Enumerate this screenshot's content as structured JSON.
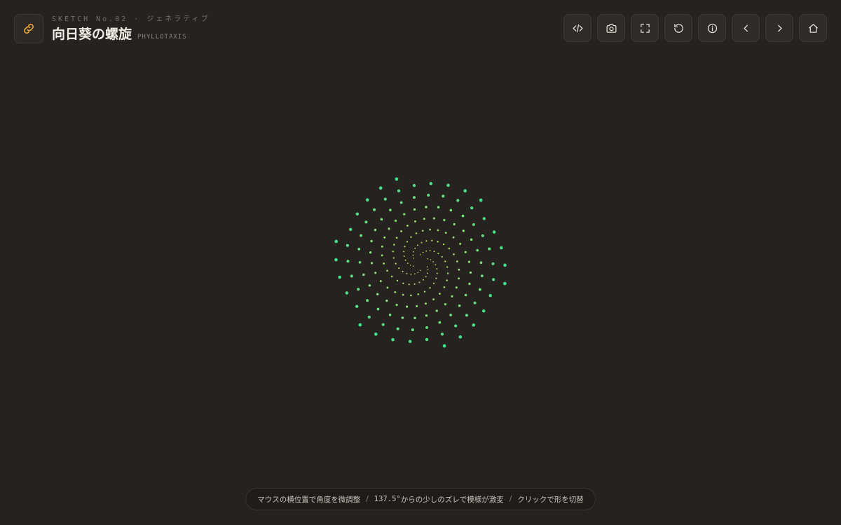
{
  "header": {
    "sketch_label": "SKETCH No.02 · ジェネラティブ",
    "title": "向日葵の螺旋",
    "subtitle": "PHYLLOTAXIS"
  },
  "colors": {
    "background": "#262220",
    "accent": "#e8a838",
    "dot_inner": "#d8e25a",
    "dot_outer": "#3ee08a"
  },
  "icons": {
    "logo": "link-icon",
    "toolbar": [
      "code-icon",
      "camera-icon",
      "fullscreen-icon",
      "reset-icon",
      "info-icon",
      "chevron-left-icon",
      "chevron-right-icon",
      "home-icon"
    ]
  },
  "hint": {
    "part1": "マウスの横位置で角度を微調整",
    "sep1": "/",
    "part2a": "137.5°",
    "part2b": "からの少しのズレで模様が激変",
    "sep2": "/",
    "part3": "クリックで形を切替"
  }
}
